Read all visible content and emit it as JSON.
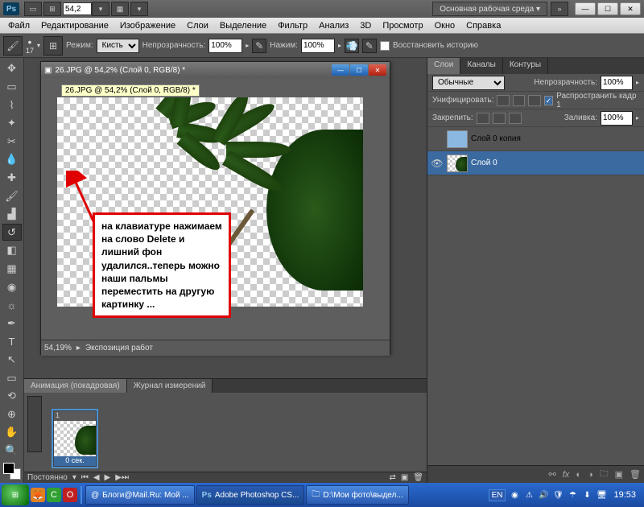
{
  "titlebar": {
    "logo": "Ps",
    "zoom_input": "54,2",
    "workspace_btn": "Основная рабочая среда",
    "chevron": "»"
  },
  "menu": {
    "file": "Файл",
    "edit": "Редактирование",
    "image": "Изображение",
    "layers": "Слои",
    "select": "Выделение",
    "filter": "Фильтр",
    "analysis": "Анализ",
    "threeD": "3D",
    "view": "Просмотр",
    "window": "Окно",
    "help": "Справка"
  },
  "options": {
    "brush_size": "17",
    "mode_label": "Режим:",
    "mode_value": "Кисть",
    "opacity_label": "Непрозрачность:",
    "opacity_value": "100%",
    "flow_label": "Нажим:",
    "flow_value": "100%",
    "restore_history": "Восстановить историю"
  },
  "document": {
    "title": "26.JPG @ 54,2% (Слой 0, RGB/8) *",
    "tooltip": "26.JPG @ 54,2% (Слой 0, RGB/8) *",
    "status_zoom": "54,19%",
    "status_text": "Экспозиция работ"
  },
  "callout": {
    "text": "на клавиатуре нажимаем на слово Delete и лишний фон удалился..теперь можно наши пальмы переместить на другую картинку ..."
  },
  "anim": {
    "tab1": "Анимация (покадровая)",
    "tab2": "Журнал измерений",
    "frame_num": "1",
    "frame_time": "0 сек.",
    "loop": "Постоянно"
  },
  "layers_panel": {
    "tab_layers": "Слои",
    "tab_channels": "Каналы",
    "tab_paths": "Контуры",
    "blend": "Обычные",
    "opacity_label": "Непрозрачность:",
    "opacity_value": "100%",
    "unify_label": "Унифицировать:",
    "propagate": "Распространить кадр 1",
    "lock_label": "Закрепить:",
    "fill_label": "Заливка:",
    "fill_value": "100%",
    "layer0_copy": "Слой 0 копия",
    "layer0": "Слой 0"
  },
  "taskbar": {
    "task1": "Блоги@Mail.Ru: Мой ...",
    "task2": "Adobe Photoshop CS...",
    "task3": "D:\\Мои фото\\выдел...",
    "lang": "EN",
    "time": "19:53"
  }
}
